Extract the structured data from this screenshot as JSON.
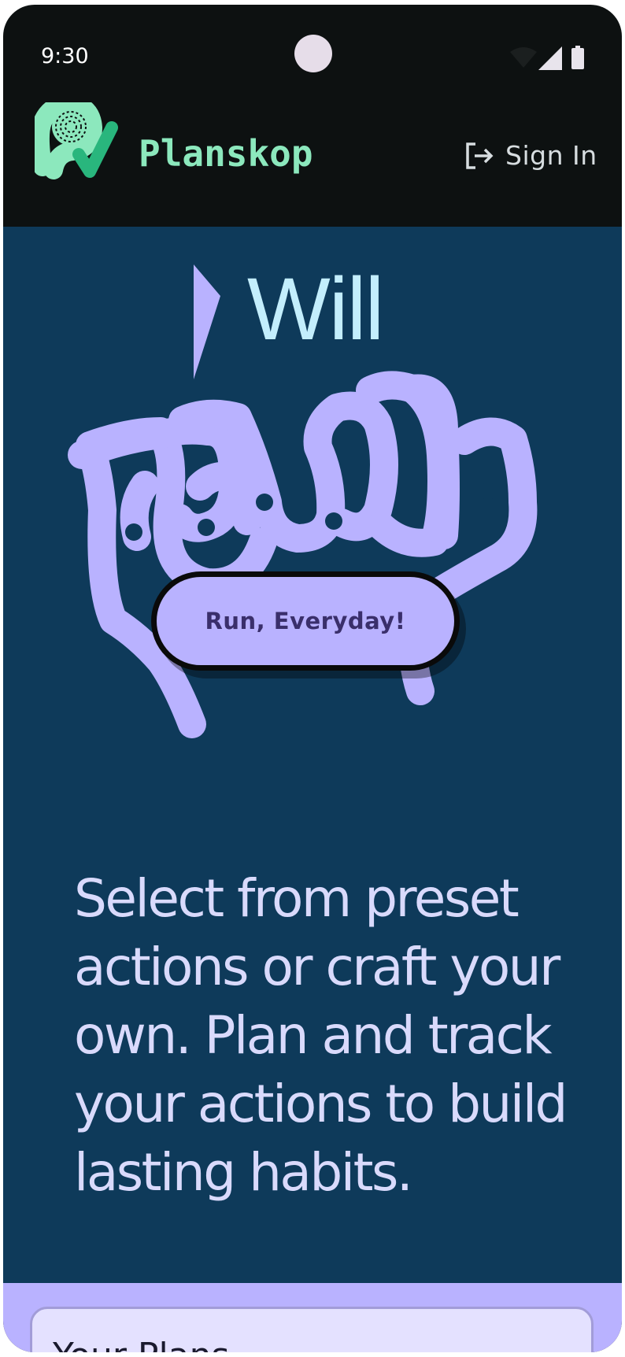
{
  "status_bar": {
    "time": "9:30",
    "icons": [
      "wifi-icon",
      "signal-icon",
      "battery-icon"
    ]
  },
  "header": {
    "brand": "Planskop",
    "sign_in": {
      "label": "Sign In",
      "icon": "sign-in-icon"
    }
  },
  "hero": {
    "title": "Will",
    "action_button": "Run, Everyday!",
    "description": "Select from preset actions or craft your own. Plan and track your actions to build lasting habits."
  },
  "plans_card": {
    "title": "Your Plans"
  },
  "colors": {
    "background_dark": "#0d1111",
    "hero_bg": "#0e3a5a",
    "accent_lavender": "#b9b2ff",
    "brand_green": "#8ce8bd",
    "title_blue": "#c3eefd"
  }
}
